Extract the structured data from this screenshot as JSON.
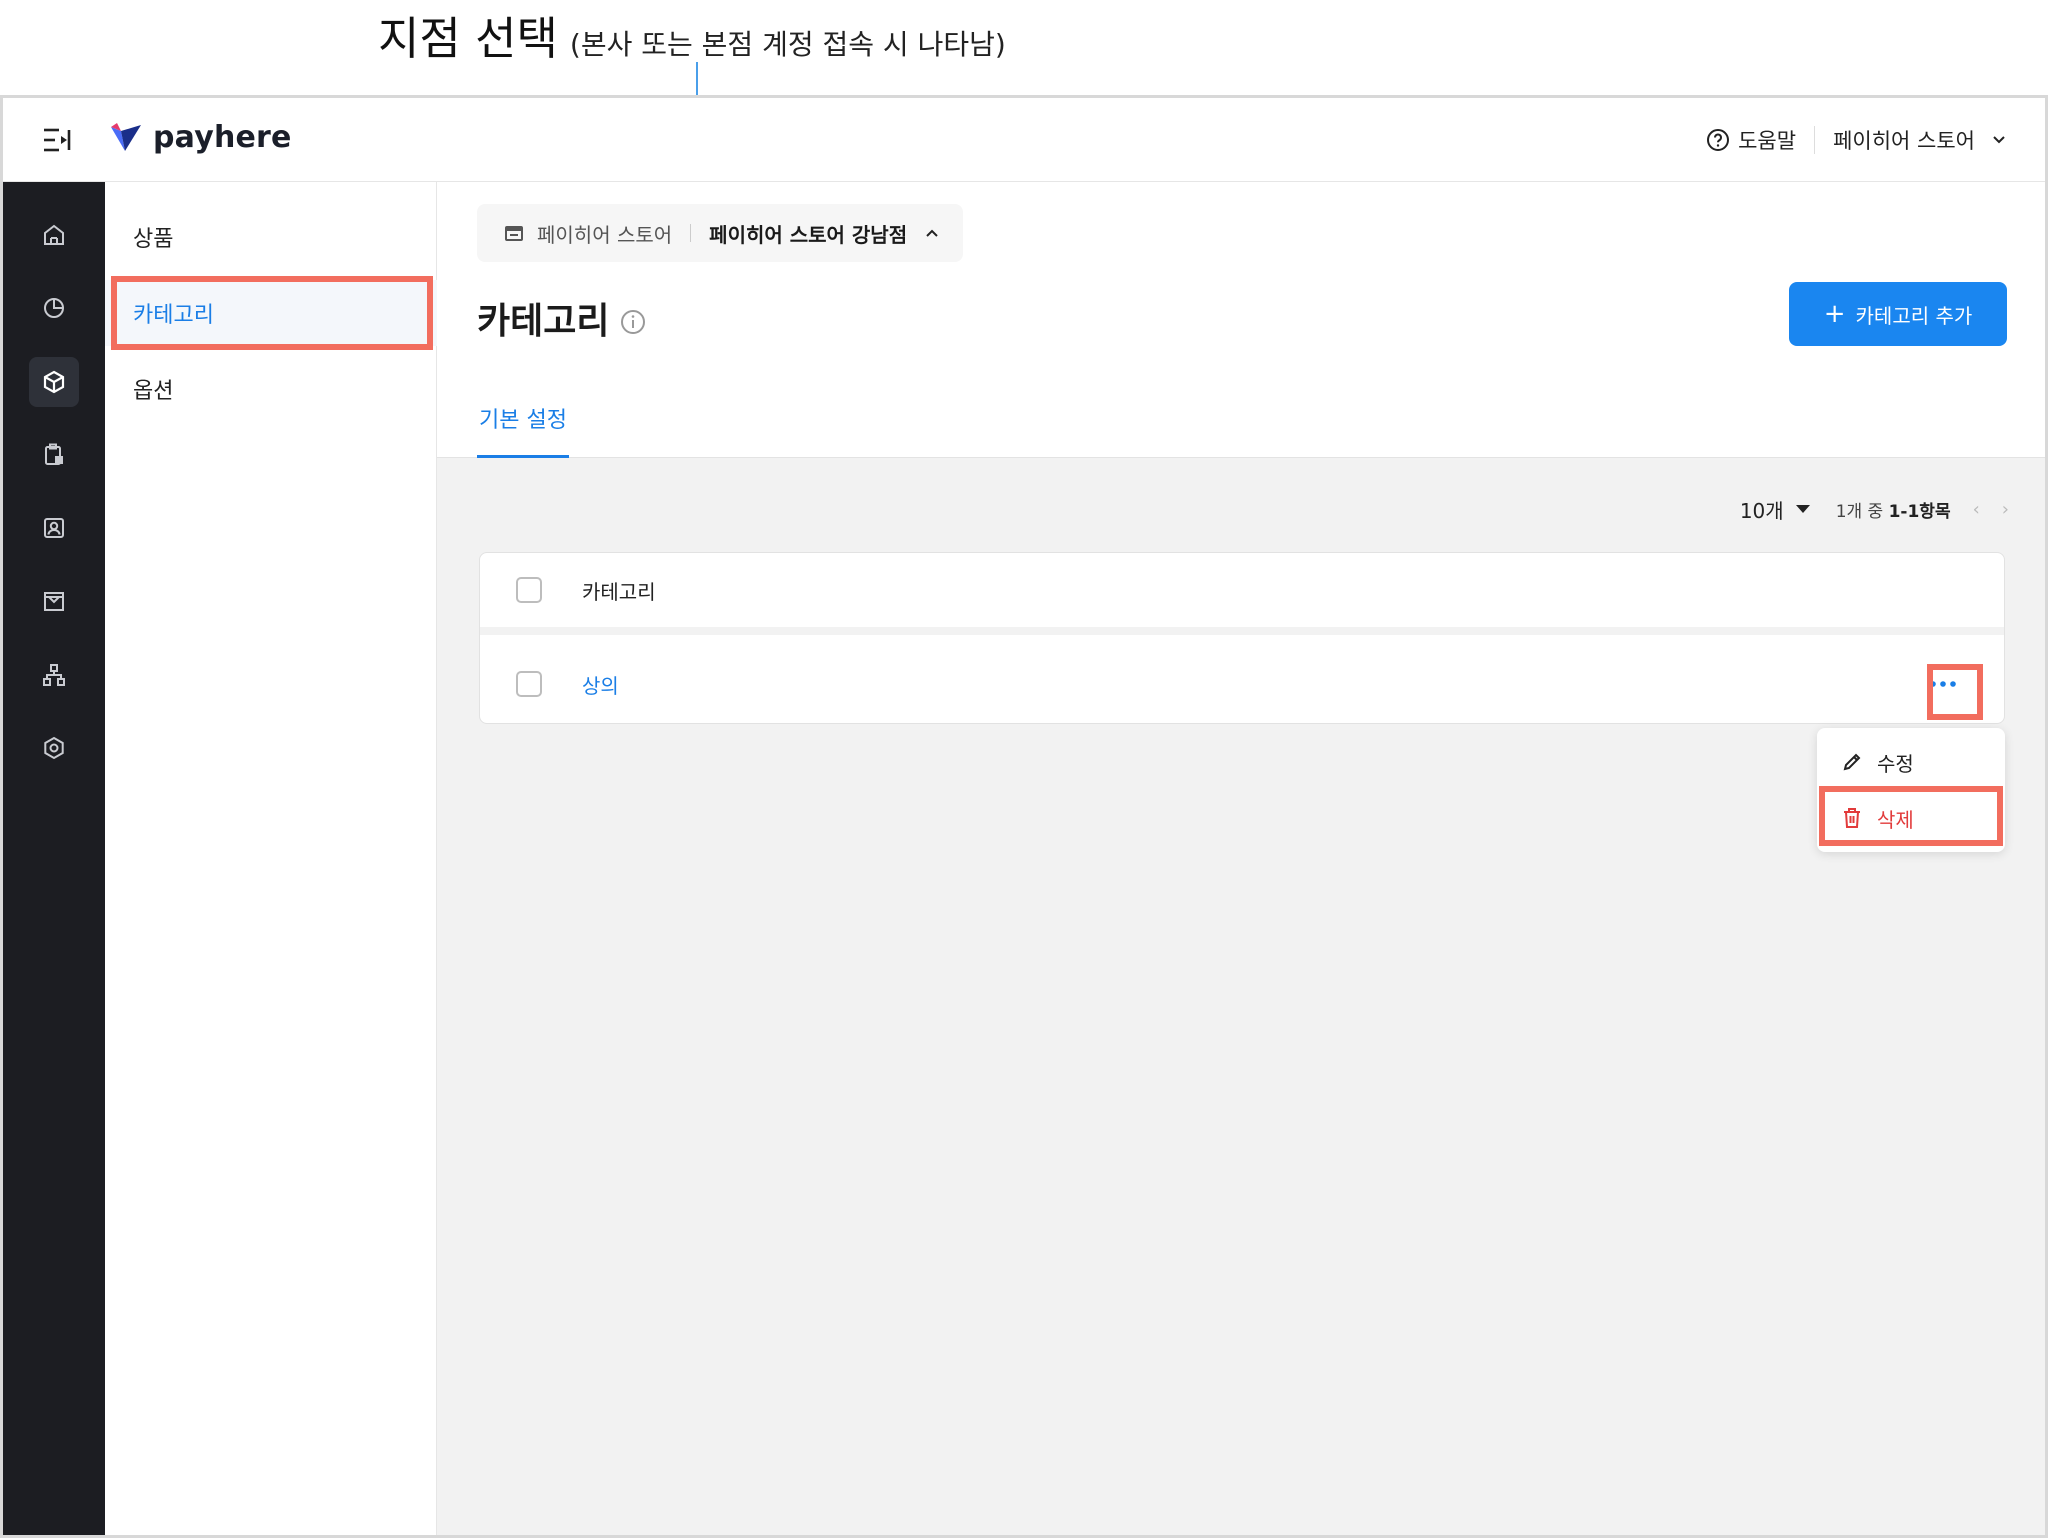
{
  "annotation": {
    "title": "지점 선택",
    "note": "(본사 또는 본점 계정 접속 시 나타남)"
  },
  "topbar": {
    "logo_text": "payhere",
    "help_label": "도움말",
    "store_name": "페이히어 스토어"
  },
  "rail": {
    "items": [
      "home-icon",
      "chart-icon",
      "product-box-icon",
      "clipboard-icon",
      "customer-icon",
      "store-icon",
      "org-chart-icon",
      "settings-icon"
    ],
    "active": "product-box-icon"
  },
  "subnav": {
    "items": [
      {
        "label": "상품"
      },
      {
        "label": "카테고리"
      },
      {
        "label": "옵션"
      }
    ],
    "active": "카테고리"
  },
  "branch_selector": {
    "hq": "페이히어 스토어",
    "current": "페이히어 스토어 강남점"
  },
  "page": {
    "title": "카테고리",
    "add_button": "카테고리 추가",
    "tab": "기본 설정"
  },
  "pagination": {
    "page_size": "10개",
    "total_prefix": "1개 중",
    "range": "1-1항목",
    "prev": "‹",
    "next": "›"
  },
  "table": {
    "header": "카테고리",
    "rows": [
      {
        "name": "상의"
      }
    ]
  },
  "row_menu": {
    "edit": "수정",
    "delete": "삭제"
  },
  "colors": {
    "accent": "#1a86f0",
    "highlight": "#f26d5e",
    "danger": "#e23b3b",
    "rail_bg": "#1c1d22"
  }
}
